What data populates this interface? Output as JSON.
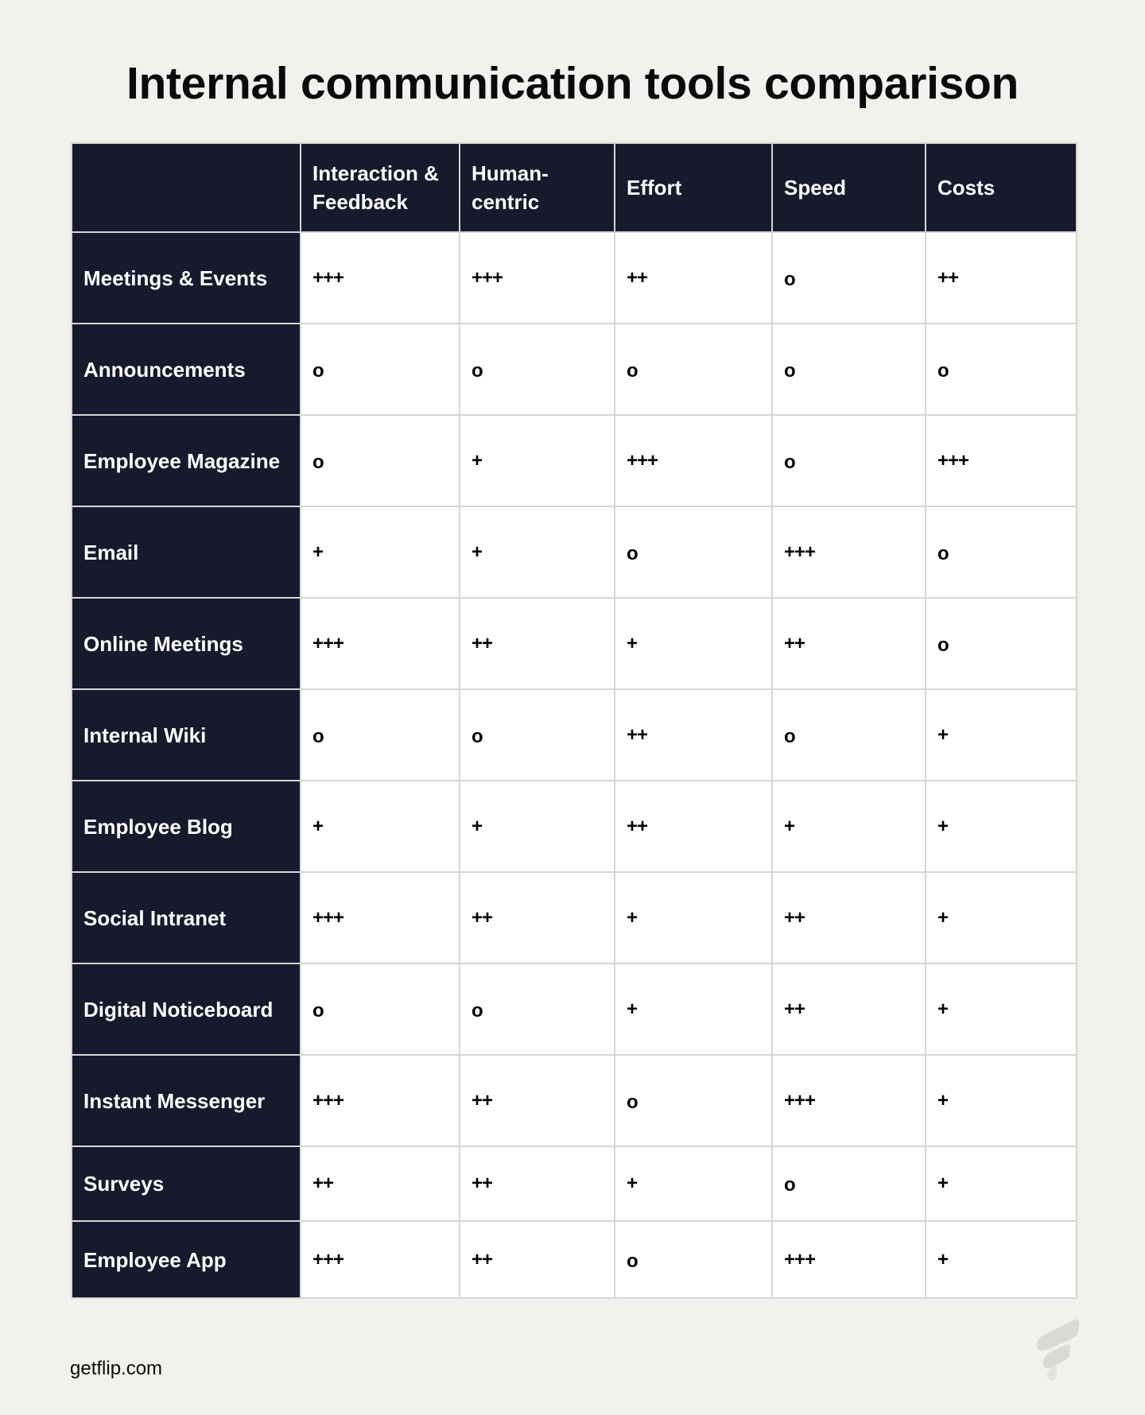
{
  "title": "Internal communication tools comparison",
  "table": {
    "columns": [
      "",
      "Interaction & Feedback",
      "Human-centric",
      "Effort",
      "Speed",
      "Costs"
    ],
    "header_lines": [
      [
        ""
      ],
      [
        "Interaction &",
        "Feedback"
      ],
      [
        "Human-",
        "centric"
      ],
      [
        "Effort"
      ],
      [
        "Speed"
      ],
      [
        "Costs"
      ]
    ],
    "rows": [
      {
        "tool": "Meetings & Events",
        "values": [
          "+++",
          "+++",
          "++",
          "o",
          "++"
        ]
      },
      {
        "tool": "Announcements",
        "values": [
          "o",
          "o",
          "o",
          "o",
          "o"
        ]
      },
      {
        "tool": "Employee Magazine",
        "values": [
          "o",
          "+",
          "+++",
          "o",
          "+++"
        ]
      },
      {
        "tool": "Email",
        "values": [
          "+",
          "+",
          "o",
          "+++",
          "o"
        ]
      },
      {
        "tool": "Online Meetings",
        "values": [
          "+++",
          "++",
          "+",
          "++",
          "o"
        ]
      },
      {
        "tool": "Internal Wiki",
        "values": [
          "o",
          "o",
          "++",
          "o",
          "+"
        ]
      },
      {
        "tool": "Employee Blog",
        "values": [
          "+",
          "+",
          "++",
          "+",
          "+"
        ]
      },
      {
        "tool": "Social Intranet",
        "values": [
          "+++",
          "++",
          "+",
          "++",
          "+"
        ]
      },
      {
        "tool": "Digital Noticeboard",
        "values": [
          "o",
          "o",
          "+",
          "++",
          "+"
        ]
      },
      {
        "tool": "Instant Messenger",
        "values": [
          "+++",
          "++",
          "o",
          "+++",
          "+"
        ]
      },
      {
        "tool": "Surveys",
        "values": [
          "++",
          "++",
          "+",
          "o",
          "+"
        ]
      },
      {
        "tool": "Employee App",
        "values": [
          "+++",
          "++",
          "o",
          "+++",
          "+"
        ]
      }
    ]
  },
  "footer": {
    "url": "getflip.com",
    "logo_icon": "flip-logo-icon"
  },
  "colors": {
    "page_background": "#f1f1ee",
    "header_background": "#171a2d",
    "header_text": "#ffffff",
    "cell_background": "#ffffff",
    "border": "#d6d6d6",
    "logo": "#d9d9d6"
  }
}
